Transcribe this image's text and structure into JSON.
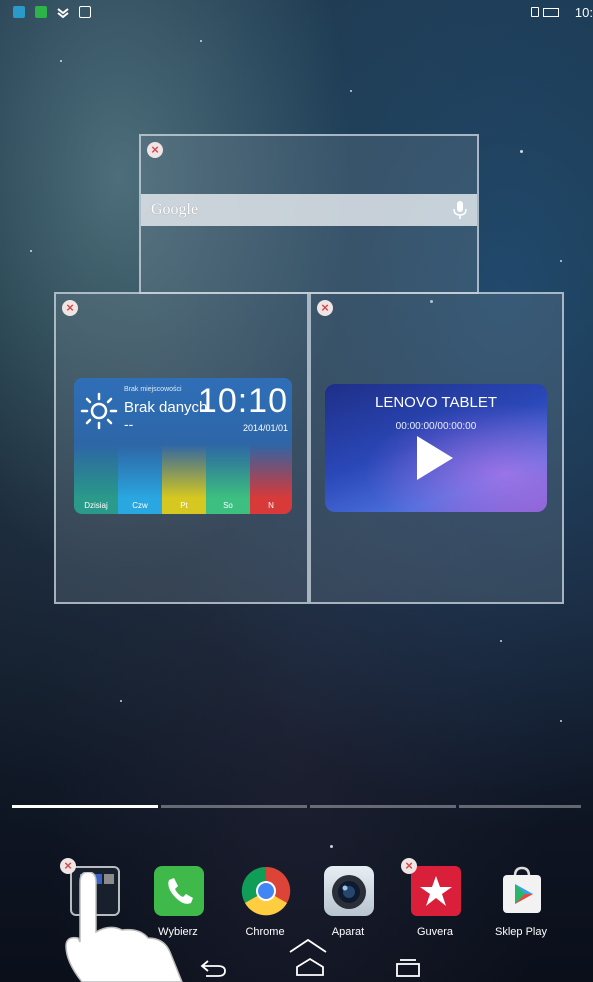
{
  "status_bar": {
    "time": "10:",
    "icons": [
      "usb-icon",
      "download-icon",
      "signal-icon",
      "image-icon"
    ]
  },
  "widgets": {
    "google": {
      "logo_text": "Google"
    },
    "weather": {
      "location": "Brak miejscowości",
      "status": "Brak danych",
      "dash": "--",
      "time": "10:10",
      "date": "2014/01/01",
      "days": [
        "Dzisiaj",
        "Czw",
        "Pt",
        "So",
        "N"
      ]
    },
    "video": {
      "title": "LENOVO TABLET",
      "time": "00:00:00/00:00:00"
    }
  },
  "dock": {
    "apps": [
      {
        "label": ""
      },
      {
        "label": "Wybierz"
      },
      {
        "label": "Chrome"
      },
      {
        "label": "Aparat"
      },
      {
        "label": "Guvera"
      },
      {
        "label": "Sklep Play"
      }
    ]
  },
  "colors": {
    "close_red": "#d54a4a",
    "phone_green": "#3fb94a",
    "guvera_red": "#d91f3a"
  }
}
